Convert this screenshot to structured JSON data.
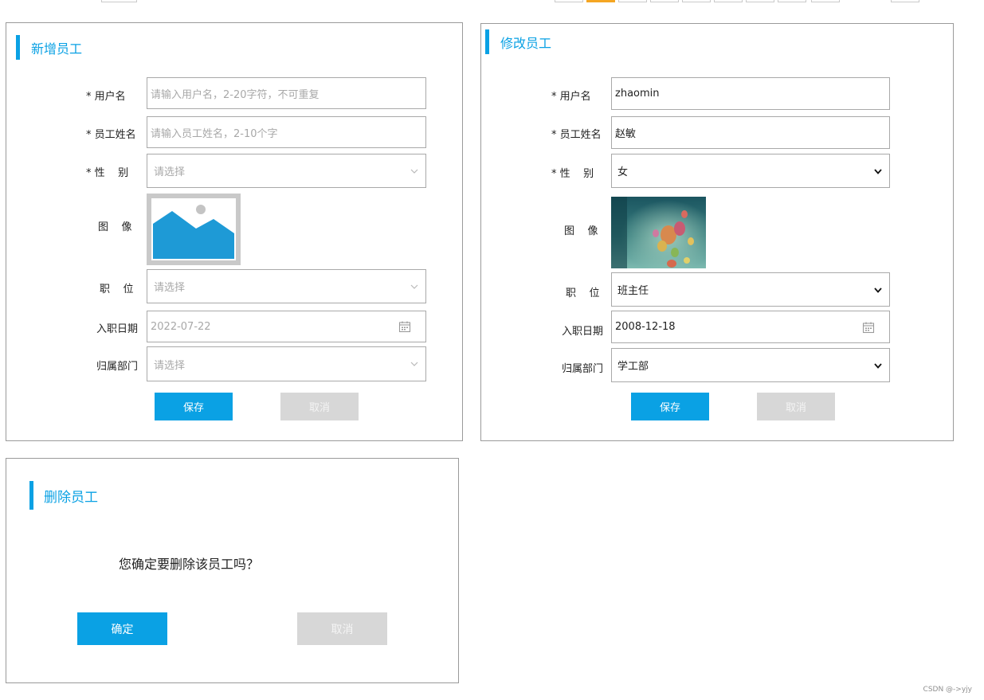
{
  "add_panel": {
    "title": "新增员工",
    "fields": {
      "username": {
        "label": "* 用户名",
        "placeholder": "请输入用户名，2-20字符，不可重复"
      },
      "name": {
        "label": "* 员工姓名",
        "placeholder": "请输入员工姓名，2-10个字"
      },
      "gender": {
        "label": "* 性    别",
        "placeholder": "请选择"
      },
      "image": {
        "label": "图    像"
      },
      "position": {
        "label": "职    位",
        "placeholder": "请选择"
      },
      "entry_date": {
        "label": "入职日期",
        "value": "2022-07-22"
      },
      "department": {
        "label": "归属部门",
        "placeholder": "请选择"
      }
    },
    "save_label": "保存",
    "cancel_label": "取消"
  },
  "edit_panel": {
    "title": "修改员工",
    "fields": {
      "username": {
        "label": "* 用户名",
        "value": "zhaomin"
      },
      "name": {
        "label": "* 员工姓名",
        "value": "赵敏"
      },
      "gender": {
        "label": "* 性    别",
        "value": "女"
      },
      "image": {
        "label": "图    像"
      },
      "position": {
        "label": "职    位",
        "value": "班主任"
      },
      "entry_date": {
        "label": "入职日期",
        "value": "2008-12-18"
      },
      "department": {
        "label": "归属部门",
        "value": "学工部"
      }
    },
    "save_label": "保存",
    "cancel_label": "取消"
  },
  "delete_panel": {
    "title": "删除员工",
    "message": "您确定要删除该员工吗？",
    "confirm_label": "确定",
    "cancel_label": "取消"
  },
  "watermark": "CSDN @->yjy",
  "colors": {
    "accent": "#0aa1e4",
    "disabled": "#d7d7d7",
    "pager_active": "#f5a623"
  },
  "icons": {
    "select": "chevron-down-icon",
    "date": "calendar-icon",
    "image_placeholder": "image-placeholder-icon"
  }
}
